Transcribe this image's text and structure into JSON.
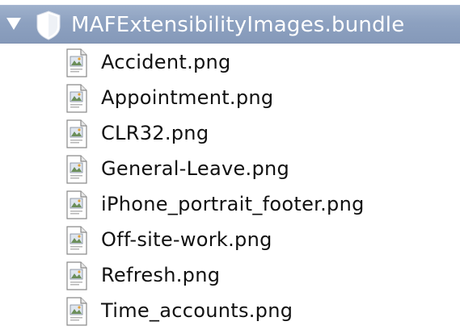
{
  "bundle": {
    "name": "MAFExtensibilityImages.bundle",
    "icon": "bundle-icon",
    "expanded": true
  },
  "files": [
    {
      "name": "Accident.png",
      "icon": "image-file-icon"
    },
    {
      "name": "Appointment.png",
      "icon": "image-file-icon"
    },
    {
      "name": "CLR32.png",
      "icon": "image-file-icon"
    },
    {
      "name": "General-Leave.png",
      "icon": "image-file-icon"
    },
    {
      "name": "iPhone_portrait_footer.png",
      "icon": "image-file-icon"
    },
    {
      "name": "Off-site-work.png",
      "icon": "image-file-icon"
    },
    {
      "name": "Refresh.png",
      "icon": "image-file-icon"
    },
    {
      "name": "Time_accounts.png",
      "icon": "image-file-icon"
    }
  ],
  "colors": {
    "selection": "#8da1c0",
    "text": "#111111",
    "selected_text": "#ffffff"
  }
}
